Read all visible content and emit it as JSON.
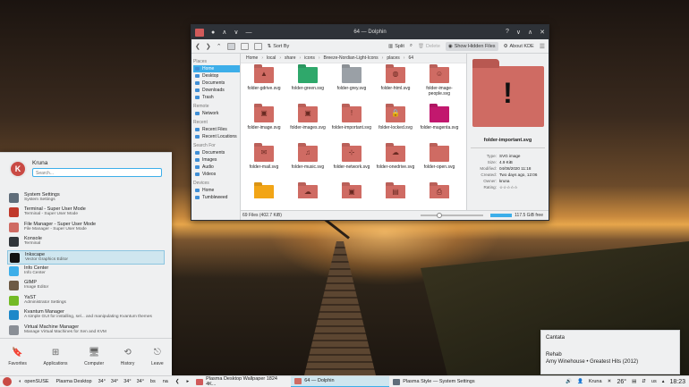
{
  "window": {
    "title": "64 — Dolphin",
    "toolbar": {
      "split": "Split",
      "delete": "Delete",
      "sort_by": "Sort By",
      "show_hidden": "Show Hidden Files",
      "about": "About KDE"
    },
    "breadcrumb": [
      "Home",
      "local",
      "share",
      "icons",
      "Breeze-Nordian-Light-Icons",
      "places",
      "64"
    ],
    "places": {
      "sections": [
        {
          "title": "Places",
          "items": [
            "Home",
            "Desktop",
            "Documents",
            "Downloads",
            "Trash"
          ]
        },
        {
          "title": "Remote",
          "items": [
            "Network"
          ]
        },
        {
          "title": "Recent",
          "items": [
            "Recent Files",
            "Recent Locations"
          ]
        },
        {
          "title": "Search For",
          "items": [
            "Documents",
            "Images",
            "Audio",
            "Videos"
          ]
        },
        {
          "title": "Devices",
          "items": [
            "Home",
            "Tumbleweed"
          ]
        }
      ]
    },
    "files": [
      {
        "label": "folder-gdrive.svg",
        "color": "#cf6b63",
        "glyph": "▲"
      },
      {
        "label": "folder-green.svg",
        "color": "#2fa86b",
        "glyph": ""
      },
      {
        "label": "folder-grey.svg",
        "color": "#9aa0a6",
        "glyph": ""
      },
      {
        "label": "folder-html.svg",
        "color": "#cf6b63",
        "glyph": "◍"
      },
      {
        "label": "folder-image-people.svg",
        "color": "#cf6b63",
        "glyph": "☺"
      },
      {
        "label": "folder-image.svg",
        "color": "#cf6b63",
        "glyph": "▣"
      },
      {
        "label": "folder-images.svg",
        "color": "#cf6b63",
        "glyph": "▣"
      },
      {
        "label": "folder-important.svg",
        "color": "#cf6b63",
        "glyph": "!"
      },
      {
        "label": "folder-locked.svg",
        "color": "#cf6b63",
        "glyph": "🔒"
      },
      {
        "label": "folder-magenta.svg",
        "color": "#c2186e",
        "glyph": ""
      },
      {
        "label": "folder-mail.svg",
        "color": "#cf6b63",
        "glyph": "✉"
      },
      {
        "label": "folder-music.svg",
        "color": "#cf6b63",
        "glyph": "♫"
      },
      {
        "label": "folder-network.svg",
        "color": "#cf6b63",
        "glyph": "⊹"
      },
      {
        "label": "folder-onedrive.svg",
        "color": "#cf6b63",
        "glyph": "☁"
      },
      {
        "label": "folder-open.svg",
        "color": "#cf6b63",
        "glyph": ""
      },
      {
        "label": "",
        "color": "#f2a516",
        "glyph": ""
      },
      {
        "label": "",
        "color": "#cf6b63",
        "glyph": "☁"
      },
      {
        "label": "",
        "color": "#cf6b63",
        "glyph": "▣"
      },
      {
        "label": "",
        "color": "#cf6b63",
        "glyph": "▤"
      },
      {
        "label": "",
        "color": "#cf6b63",
        "glyph": "⎙"
      }
    ],
    "info": {
      "name": "folder-important.svg",
      "props": [
        {
          "k": "Type:",
          "v": "SVG image"
        },
        {
          "k": "Size:",
          "v": "4.9 KiB"
        },
        {
          "k": "Modified:",
          "v": "04/08/2020 11:18"
        },
        {
          "k": "Created:",
          "v": "Two days ago, 12:06"
        },
        {
          "k": "Owner:",
          "v": "kruna"
        },
        {
          "k": "Rating:",
          "v": "☆☆☆☆☆"
        }
      ]
    },
    "status": {
      "count": "69 Files (402.7 KiB)",
      "free": "117.5 GiB free",
      "zoom_fraction": 0.28
    }
  },
  "launcher": {
    "user": "Kruna",
    "search_placeholder": "Search...",
    "apps": [
      {
        "name": "System Settings",
        "desc": "System Settings",
        "color": "#5f6d7a"
      },
      {
        "name": "Terminal - Super User Mode",
        "desc": "Terminal - Super User Mode",
        "color": "#c0392b"
      },
      {
        "name": "File Manager - Super User Mode",
        "desc": "File Manager - Super User Mode",
        "color": "#cf6b63"
      },
      {
        "name": "Konsole",
        "desc": "Terminal",
        "color": "#31363b"
      },
      {
        "name": "Inkscape",
        "desc": "Vector Graphics Editor",
        "color": "#111111"
      },
      {
        "name": "Info Center",
        "desc": "Info Center",
        "color": "#3daee9"
      },
      {
        "name": "GIMP",
        "desc": "Image Editor",
        "color": "#6d5a45"
      },
      {
        "name": "YaST",
        "desc": "Administrator Settings",
        "color": "#73ba25"
      },
      {
        "name": "Kvantum Manager",
        "desc": "A simple GUI for installing, sel... and manipulating Kvantum themes",
        "color": "#1e88c9"
      },
      {
        "name": "Virtual Machine Manager",
        "desc": "Manage Virtual Machines for Xen and KVM",
        "color": "#8a8f96"
      }
    ],
    "footer": [
      {
        "label": "Favorites",
        "icon": "bookmark-icon",
        "glyph": "🔖"
      },
      {
        "label": "Applications",
        "icon": "apps-grid-icon",
        "glyph": "⊞"
      },
      {
        "label": "Computer",
        "icon": "computer-icon",
        "glyph": "🖥"
      },
      {
        "label": "History",
        "icon": "history-icon",
        "glyph": "⟲"
      },
      {
        "label": "Leave",
        "icon": "leave-icon",
        "glyph": "⎋"
      }
    ]
  },
  "notification": {
    "player": "Cantata",
    "track": "Rehab",
    "artist_album": "Amy Winehouse • Greatest Hits (2012)"
  },
  "taskbar": {
    "desktop_label": "openSUSE",
    "plasma_label": "Plasma Desktop",
    "temps": [
      "34°",
      "34°",
      "34°",
      "34°"
    ],
    "keyboard": "bs",
    "na": "na",
    "tasks": [
      {
        "label": "Plasma Desktop Wallpaper 1824 4K...",
        "color": "#d05a5a"
      },
      {
        "label": "64 — Dolphin",
        "color": "#cf6b63"
      },
      {
        "label": "Plasma Style — System Settings",
        "color": "#5f6d7a"
      }
    ],
    "user": "Kruna",
    "weather": "26°",
    "locale": "us",
    "time": "18:23"
  }
}
